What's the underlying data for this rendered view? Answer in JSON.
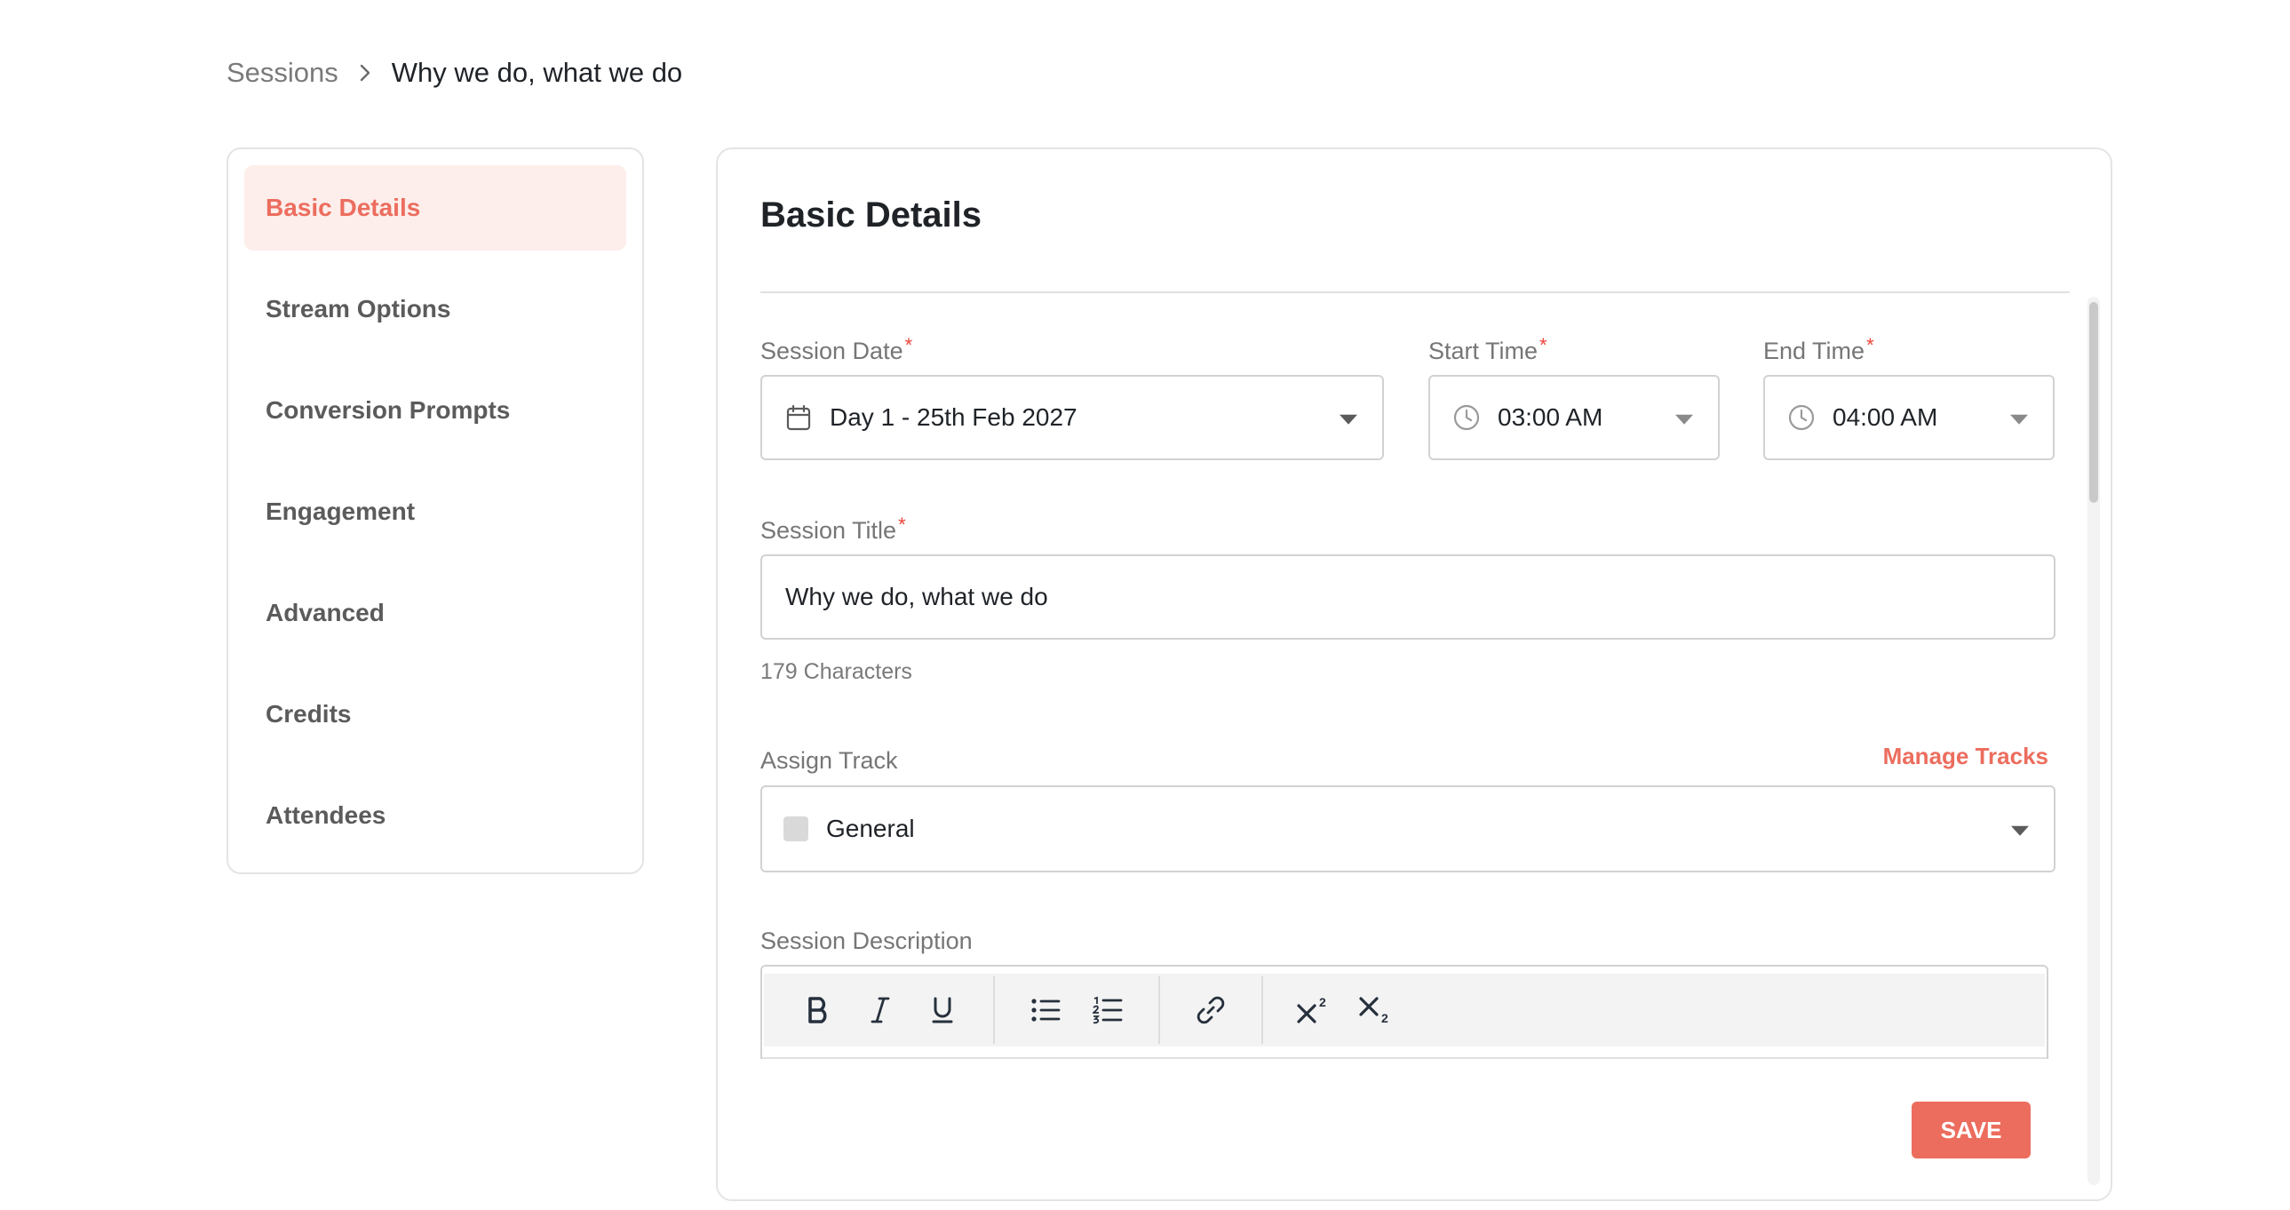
{
  "breadcrumb": {
    "root": "Sessions",
    "current": "Why we do, what we do"
  },
  "sidebar": {
    "items": [
      {
        "label": "Basic Details",
        "active": true
      },
      {
        "label": "Stream Options",
        "active": false
      },
      {
        "label": "Conversion Prompts",
        "active": false
      },
      {
        "label": "Engagement",
        "active": false
      },
      {
        "label": "Advanced",
        "active": false
      },
      {
        "label": "Credits",
        "active": false
      },
      {
        "label": "Attendees",
        "active": false
      }
    ]
  },
  "panel": {
    "title": "Basic Details"
  },
  "form": {
    "session_date": {
      "label": "Session Date",
      "value": "Day 1 - 25th Feb 2027",
      "icon": "calendar-icon"
    },
    "start_time": {
      "label": "Start Time",
      "value": "03:00 AM",
      "icon": "clock-icon"
    },
    "end_time": {
      "label": "End Time",
      "value": "04:00 AM",
      "icon": "clock-icon"
    },
    "session_title": {
      "label": "Session Title",
      "value": "Why we do, what we do",
      "helper": "179 Characters"
    },
    "assign_track": {
      "label": "Assign Track",
      "value": "General",
      "manage_link": "Manage Tracks"
    },
    "session_description": {
      "label": "Session Description"
    },
    "required_marker": "*"
  },
  "toolbar": {
    "buttons": [
      "bold-icon",
      "italic-icon",
      "underline-icon",
      "bulleted-list-icon",
      "numbered-list-icon",
      "link-icon",
      "superscript-icon",
      "subscript-icon"
    ]
  },
  "actions": {
    "save_label": "SAVE"
  },
  "colors": {
    "accent": "#ec6d5e",
    "active_bg": "#fdeeeb",
    "required": "#e8443a",
    "border": "#d2d2d2"
  }
}
